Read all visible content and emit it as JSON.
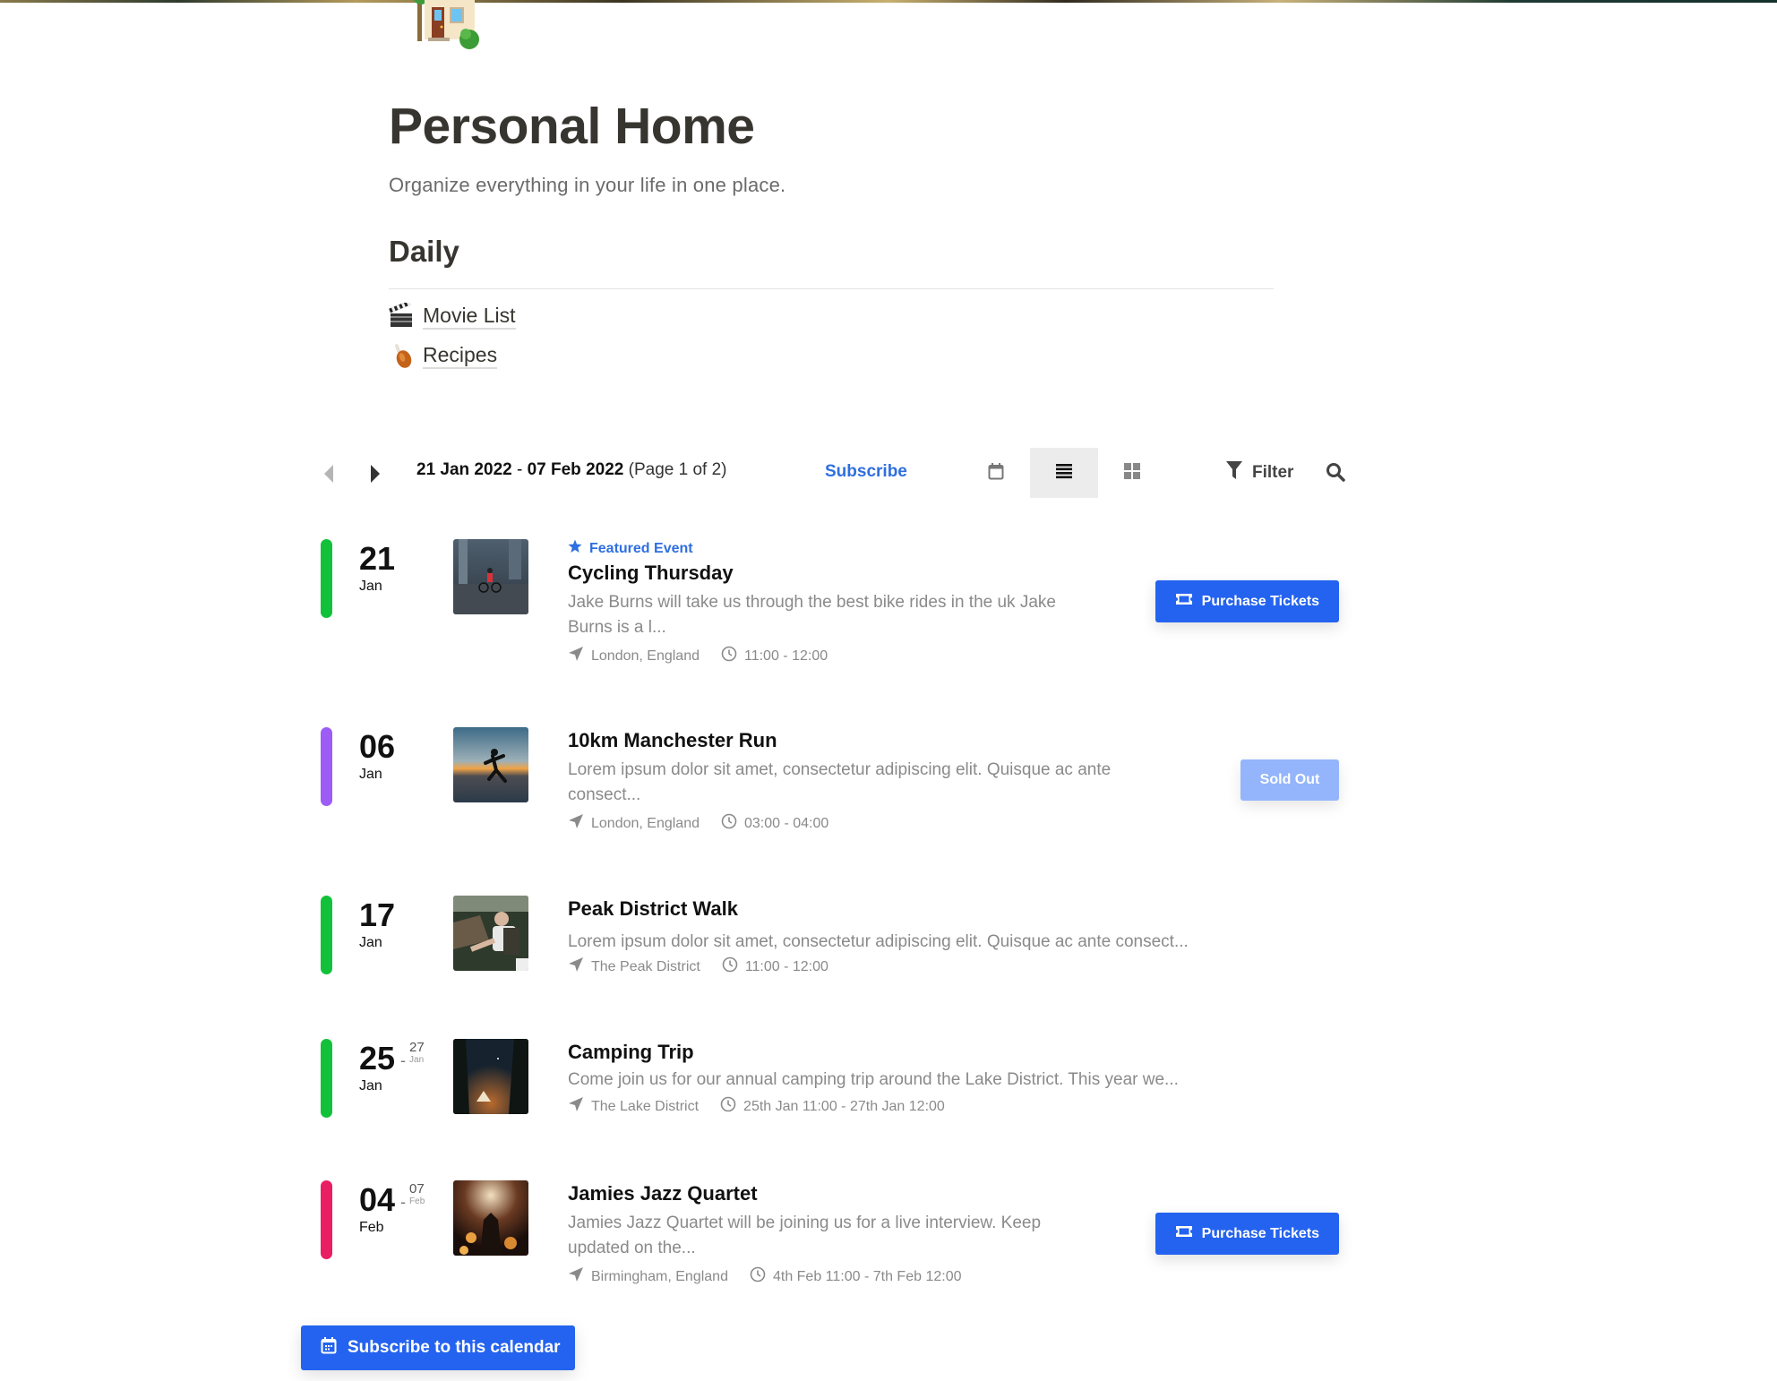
{
  "page": {
    "icon": "house-with-garden-icon",
    "title": "Personal Home",
    "subtitle": "Organize everything in your life in one place."
  },
  "daily": {
    "heading": "Daily",
    "links": [
      {
        "icon": "clapper-board-icon",
        "label": "Movie List"
      },
      {
        "icon": "poultry-leg-icon",
        "label": "Recipes"
      }
    ]
  },
  "toolbar": {
    "range_start": "21 Jan 2022",
    "range_sep": " - ",
    "range_end": "07 Feb 2022",
    "page_info": " (Page 1 of 2)",
    "subscribe_label": "Subscribe",
    "views": [
      "calendar-view",
      "list-view",
      "grid-view"
    ],
    "active_view": "list-view",
    "filter_label": "Filter"
  },
  "events": [
    {
      "day": "21",
      "month": "Jan",
      "end_day": "",
      "end_month": "",
      "color": "#12c13a",
      "featured": true,
      "featured_label": "Featured Event",
      "title": "Cycling Thursday",
      "description": "Jake Burns will take us through the best bike rides in the uk Jake Burns is a l...",
      "location": "London, England",
      "time": "11:00 - 12:00",
      "action": "Purchase Tickets",
      "action_type": "purchase"
    },
    {
      "day": "06",
      "month": "Jan",
      "end_day": "",
      "end_month": "",
      "color": "#9d5cf5",
      "featured": false,
      "featured_label": "",
      "title": "10km Manchester Run",
      "description": "Lorem ipsum dolor sit amet, consectetur adipiscing elit. Quisque ac ante consect...",
      "location": "London, England",
      "time": "03:00 - 04:00",
      "action": "Sold Out",
      "action_type": "soldout"
    },
    {
      "day": "17",
      "month": "Jan",
      "end_day": "",
      "end_month": "",
      "color": "#12c13a",
      "featured": false,
      "featured_label": "",
      "title": "Peak District Walk",
      "description": "Lorem ipsum dolor sit amet, consectetur adipiscing elit. Quisque ac ante consect...",
      "location": "The Peak District",
      "time": "11:00 - 12:00",
      "action": "",
      "action_type": "none"
    },
    {
      "day": "25",
      "month": "Jan",
      "end_day": "27",
      "end_month": "Jan",
      "color": "#12c13a",
      "featured": false,
      "featured_label": "",
      "title": "Camping Trip",
      "description": "Come join us for our annual camping trip around the Lake District. This year we...",
      "location": "The Lake District",
      "time": "25th Jan 11:00 - 27th Jan 12:00",
      "action": "",
      "action_type": "none"
    },
    {
      "day": "04",
      "month": "Feb",
      "end_day": "07",
      "end_month": "Feb",
      "color": "#e91e63",
      "featured": false,
      "featured_label": "",
      "title": "Jamies Jazz Quartet",
      "description": "Jamies Jazz Quartet will be joining us for a live interview. Keep updated on the...",
      "location": "Birmingham, England",
      "time": "4th Feb 11:00 - 7th Feb 12:00",
      "action": "Purchase Tickets",
      "action_type": "purchase"
    }
  ],
  "footer": {
    "subscribe_calendar_label": "Subscribe to this calendar"
  },
  "colors": {
    "accent": "#2463ef",
    "link_blue": "#2f6fe0",
    "sold_out": "#94b5fb"
  }
}
